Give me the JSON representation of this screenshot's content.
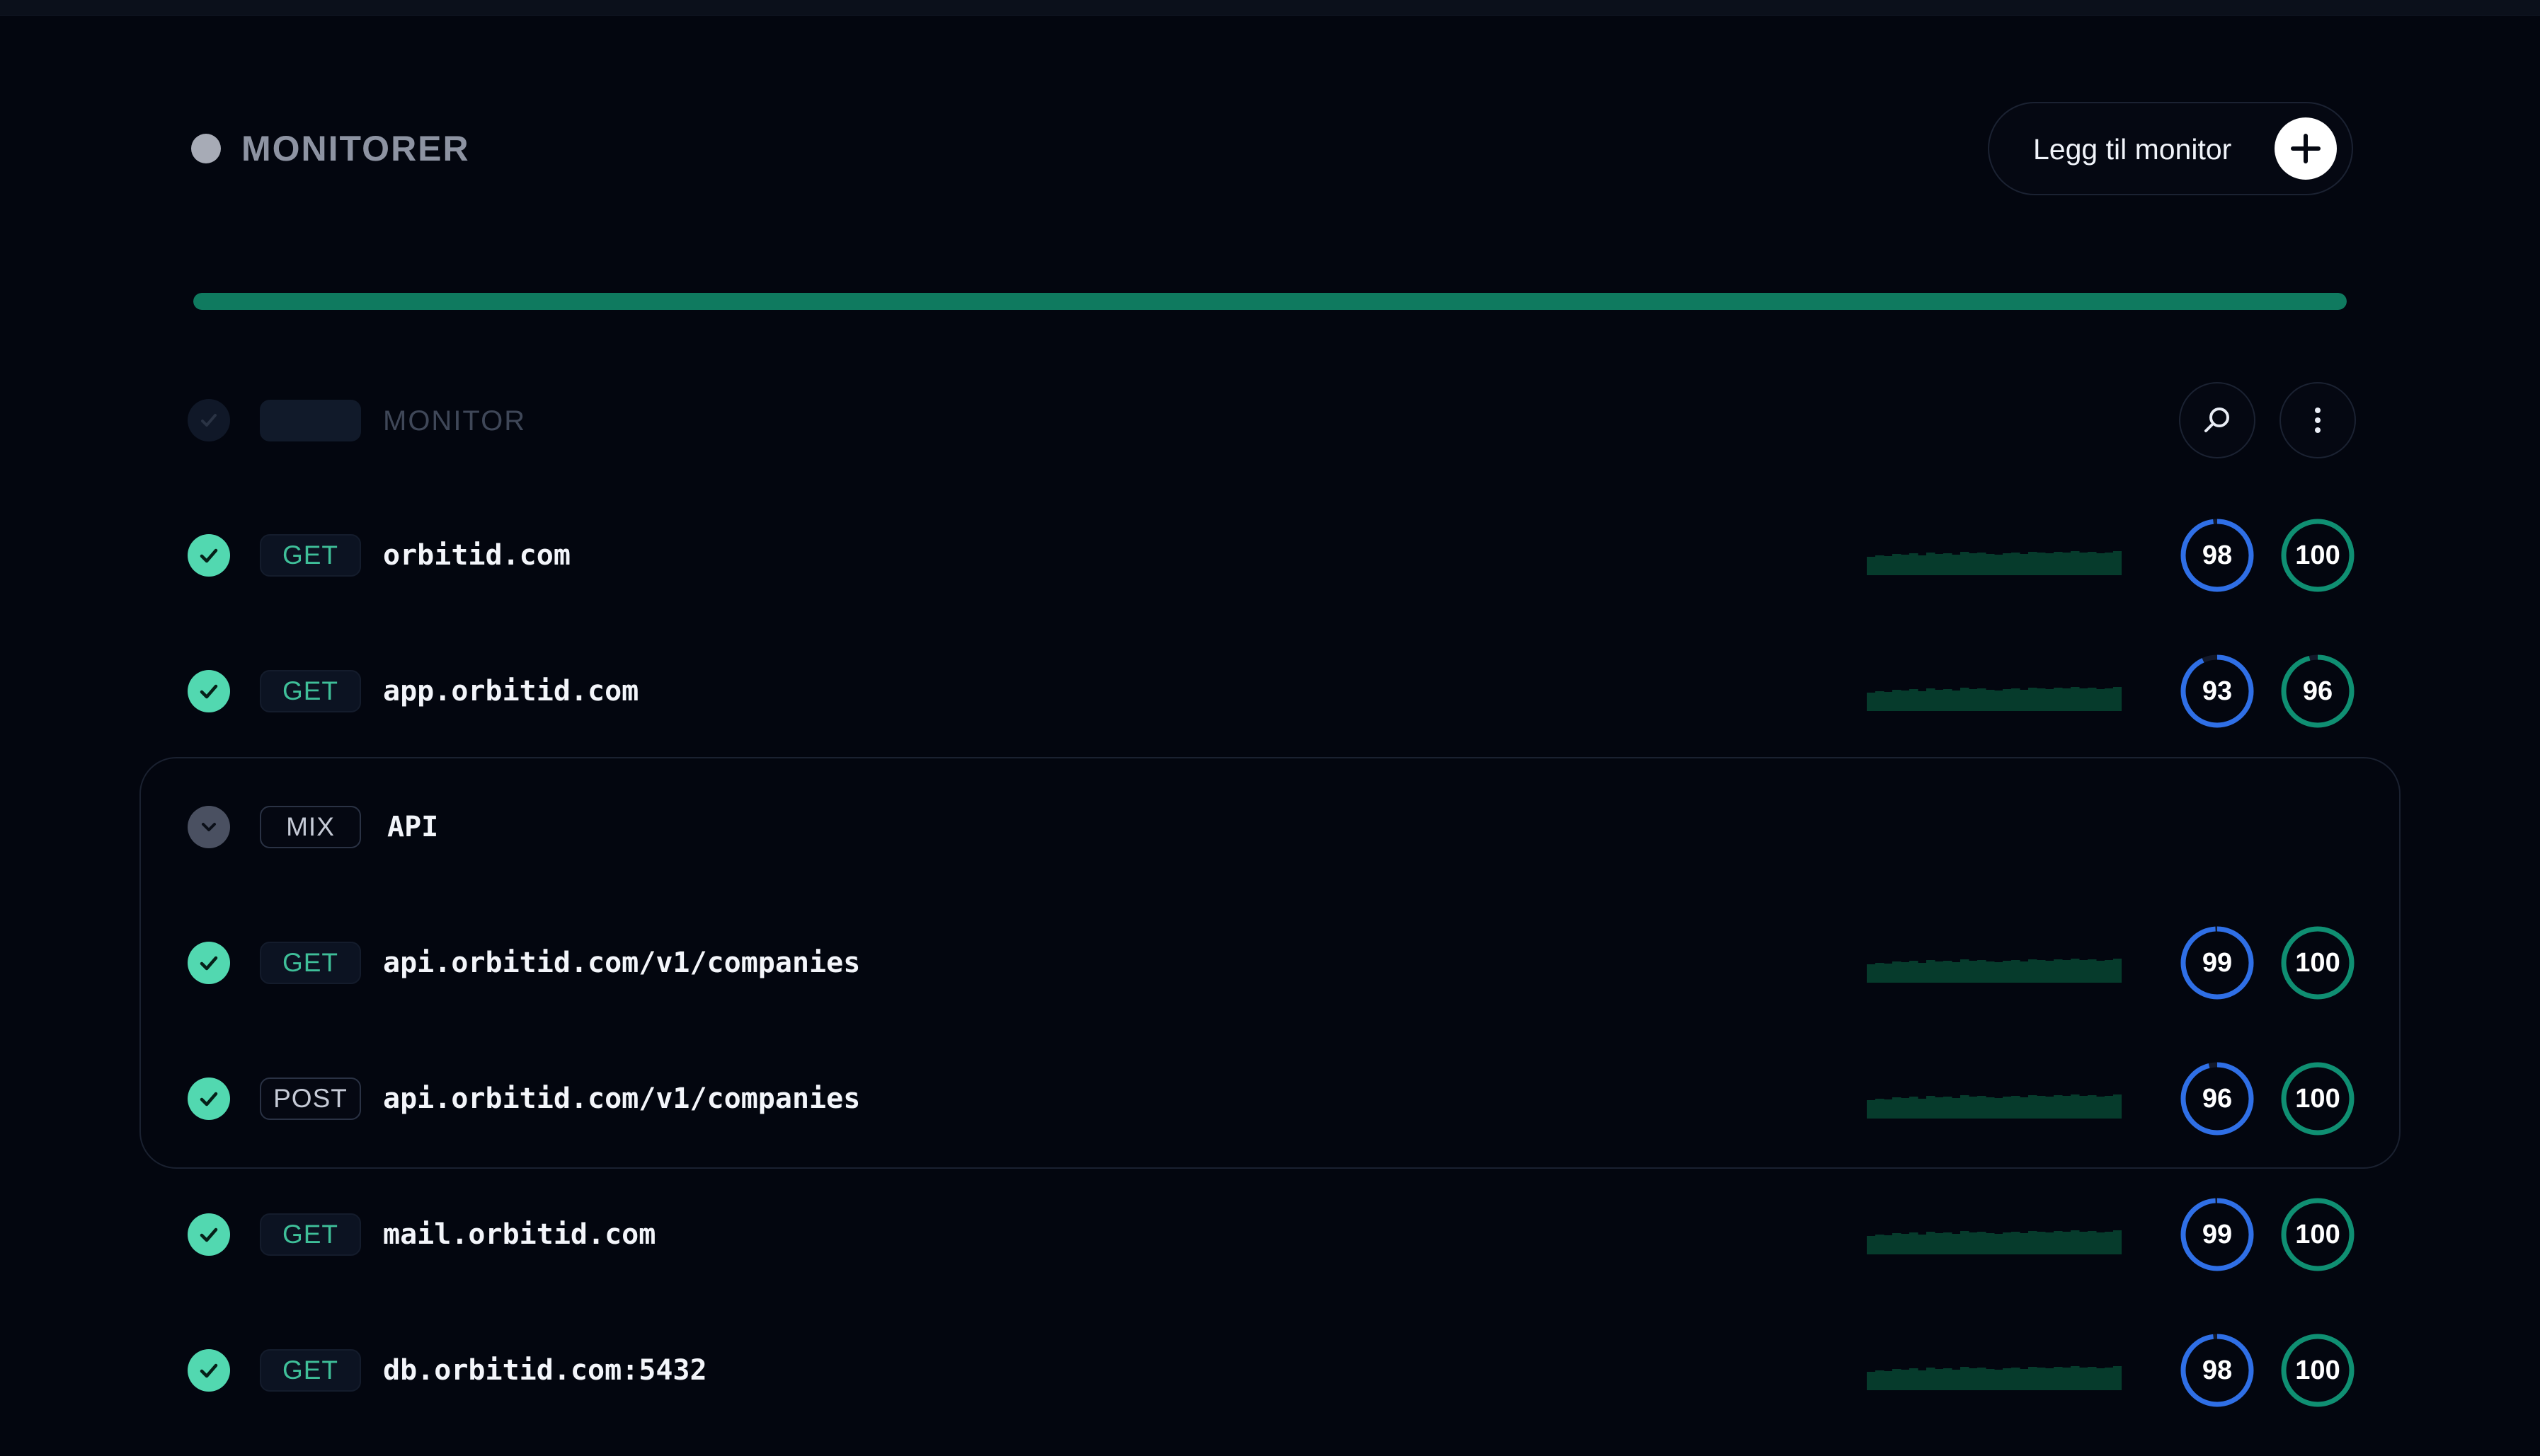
{
  "header": {
    "title": "MONITORER",
    "add_button_label": "Legg til monitor"
  },
  "progress": {
    "percent": 100
  },
  "table_header": {
    "label": "MONITOR"
  },
  "colors": {
    "status_ok": "#52d8b0",
    "progress": "#0f7a5f",
    "uptime_ring": "#2f6fe6",
    "health_ring": "#0f8f72"
  },
  "rows": [
    {
      "method": "GET",
      "url": "orbitid.com",
      "uptime": 98,
      "health": 100
    },
    {
      "method": "GET",
      "url": "app.orbitid.com",
      "uptime": 93,
      "health": 96
    }
  ],
  "group": {
    "method": "MIX",
    "name": "API",
    "rows": [
      {
        "method": "GET",
        "url": "api.orbitid.com/v1/companies",
        "uptime": 99,
        "health": 100
      },
      {
        "method": "POST",
        "url": "api.orbitid.com/v1/companies",
        "uptime": 96,
        "health": 100
      }
    ]
  },
  "rows_after": [
    {
      "method": "GET",
      "url": "mail.orbitid.com",
      "uptime": 99,
      "health": 100
    },
    {
      "method": "GET",
      "url": "db.orbitid.com:5432",
      "uptime": 98,
      "health": 100
    }
  ],
  "icons": {
    "status": "check-icon",
    "group_toggle": "chevron-down-icon",
    "search": "search-icon",
    "menu": "more-vertical-icon",
    "add": "plus-icon"
  }
}
